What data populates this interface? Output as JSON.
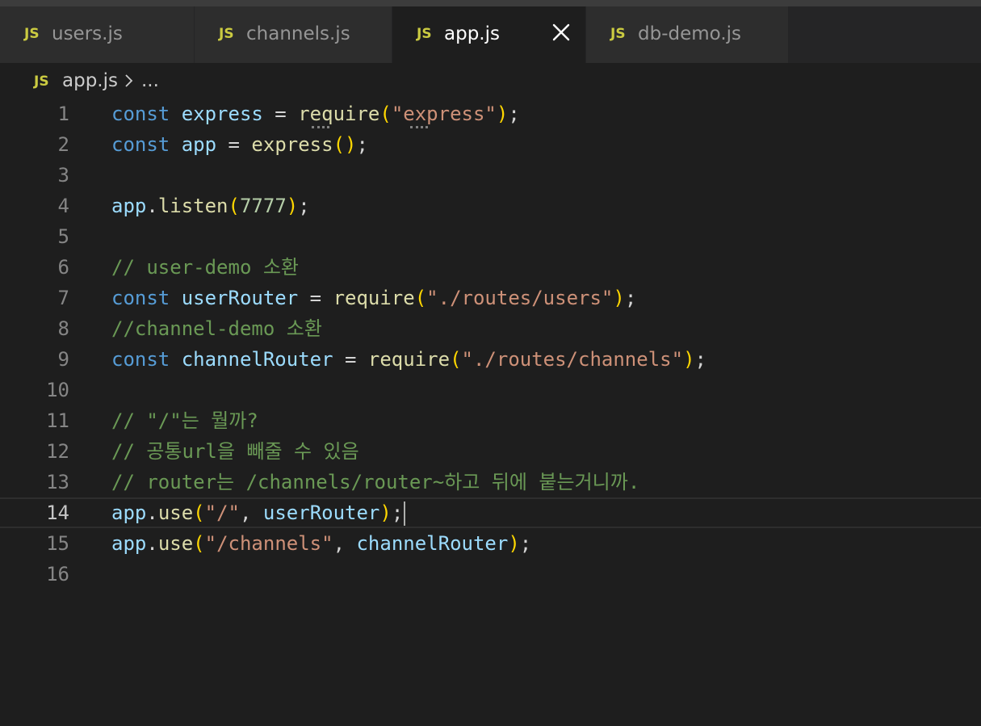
{
  "tabs": [
    {
      "icon": "JS",
      "label": "users.js",
      "active": false
    },
    {
      "icon": "JS",
      "label": "channels.js",
      "active": false
    },
    {
      "icon": "JS",
      "label": "app.js",
      "active": true
    },
    {
      "icon": "JS",
      "label": "db-demo.js",
      "active": false
    }
  ],
  "breadcrumb": {
    "icon": "JS",
    "file": "app.js",
    "more": "..."
  },
  "current_line": 14,
  "lines": [
    {
      "n": "1",
      "t": [
        [
          "kw",
          "const"
        ],
        [
          "pun",
          " "
        ],
        [
          "var",
          "express"
        ],
        [
          "pun",
          " = "
        ],
        [
          "fn",
          "require"
        ],
        [
          "br",
          "("
        ],
        [
          "str",
          "\"express\""
        ],
        [
          "br",
          ")"
        ],
        [
          "pun",
          ";"
        ]
      ]
    },
    {
      "n": "2",
      "t": [
        [
          "kw",
          "const"
        ],
        [
          "pun",
          " "
        ],
        [
          "var",
          "app"
        ],
        [
          "pun",
          " = "
        ],
        [
          "fn",
          "express"
        ],
        [
          "br",
          "()"
        ],
        [
          "pun",
          ";"
        ]
      ]
    },
    {
      "n": "3",
      "t": []
    },
    {
      "n": "4",
      "t": [
        [
          "var",
          "app"
        ],
        [
          "pun",
          "."
        ],
        [
          "fn",
          "listen"
        ],
        [
          "br",
          "("
        ],
        [
          "num",
          "7777"
        ],
        [
          "br",
          ")"
        ],
        [
          "pun",
          ";"
        ]
      ]
    },
    {
      "n": "5",
      "t": []
    },
    {
      "n": "6",
      "t": [
        [
          "cmt",
          "// user-demo 소환"
        ]
      ]
    },
    {
      "n": "7",
      "t": [
        [
          "kw",
          "const"
        ],
        [
          "pun",
          " "
        ],
        [
          "var",
          "userRouter"
        ],
        [
          "pun",
          " = "
        ],
        [
          "fn",
          "require"
        ],
        [
          "br",
          "("
        ],
        [
          "str",
          "\"./routes/users\""
        ],
        [
          "br",
          ")"
        ],
        [
          "pun",
          ";"
        ]
      ]
    },
    {
      "n": "8",
      "t": [
        [
          "cmt",
          "//channel-demo 소환"
        ]
      ]
    },
    {
      "n": "9",
      "t": [
        [
          "kw",
          "const"
        ],
        [
          "pun",
          " "
        ],
        [
          "var",
          "channelRouter"
        ],
        [
          "pun",
          " = "
        ],
        [
          "fn",
          "require"
        ],
        [
          "br",
          "("
        ],
        [
          "str",
          "\"./routes/channels\""
        ],
        [
          "br",
          ")"
        ],
        [
          "pun",
          ";"
        ]
      ]
    },
    {
      "n": "10",
      "t": []
    },
    {
      "n": "11",
      "t": [
        [
          "cmt",
          "// \"/\"는 뭘까?"
        ]
      ]
    },
    {
      "n": "12",
      "t": [
        [
          "cmt",
          "// 공통url을 빼줄 수 있음"
        ]
      ]
    },
    {
      "n": "13",
      "t": [
        [
          "cmt",
          "// router는 /channels/router~하고 뒤에 붙는거니까."
        ]
      ]
    },
    {
      "n": "14",
      "t": [
        [
          "var",
          "app"
        ],
        [
          "pun",
          "."
        ],
        [
          "fn",
          "use"
        ],
        [
          "br",
          "("
        ],
        [
          "str",
          "\"/\""
        ],
        [
          "pun",
          ", "
        ],
        [
          "var",
          "userRouter"
        ],
        [
          "br",
          ")"
        ],
        [
          "pun",
          ";"
        ]
      ]
    },
    {
      "n": "15",
      "t": [
        [
          "var",
          "app"
        ],
        [
          "pun",
          "."
        ],
        [
          "fn",
          "use"
        ],
        [
          "br",
          "("
        ],
        [
          "str",
          "\"/channels\""
        ],
        [
          "pun",
          ", "
        ],
        [
          "var",
          "channelRouter"
        ],
        [
          "br",
          ")"
        ],
        [
          "pun",
          ";"
        ]
      ]
    },
    {
      "n": "16",
      "t": []
    }
  ]
}
